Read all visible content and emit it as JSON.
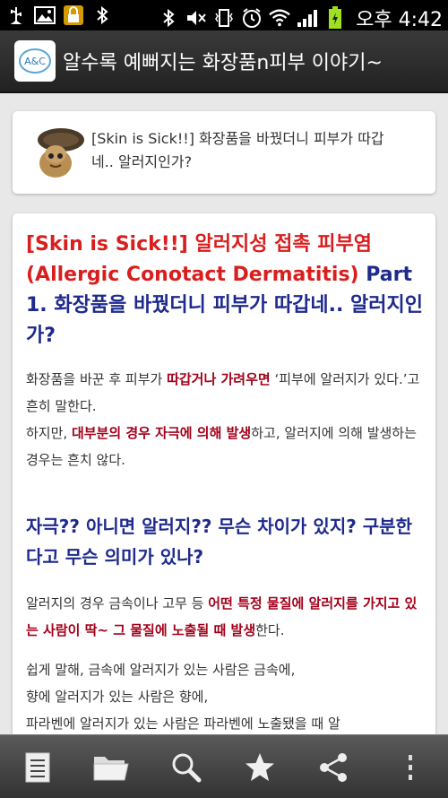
{
  "status_bar": {
    "left_icons": [
      "usb-icon",
      "image-icon",
      "lock-icon",
      "bluetooth-icon"
    ],
    "right_icons": [
      "bluetooth-icon",
      "mute-icon",
      "vibrate-icon",
      "alarm-icon",
      "wifi-icon",
      "signal-icon",
      "battery-icon"
    ],
    "clock": "오후 4:42"
  },
  "action_bar": {
    "app_logo_text": "A&C",
    "title": "알수록 예뻐지는 화장품n피부 이야기~"
  },
  "preview": {
    "title": "[Skin is Sick!!] 화장품을 바꿨더니 피부가 따갑네.. 알러지인가?"
  },
  "article": {
    "title_red": "[Skin is Sick!!] 알러지성 접촉 피부염 (Allergic Conotact Dermatitis)",
    "title_navy": " Part 1. 화장품을 바꿨더니 피부가 따갑네.. 알러지인가?",
    "p1": {
      "a": "화장품을 바꾼 후 피부가 ",
      "b": "따갑거나 가려우면",
      "c": " ‘피부에 알러지가 있다.’고 흔히 말한다."
    },
    "p2": {
      "a": "하지만, ",
      "b": "대부분의 경우 자극에 의해 발생",
      "c": "하고, 알러지에 의해 발생하는 경우는 흔치 않다."
    },
    "h2": "자극?? 아니면 알러지?? 무슨 차이가 있지? 구분한다고 무슨 의미가 있나?",
    "p3": {
      "a": "알러지의 경우 금속이나 고무 등 ",
      "b": "어떤 특정 물질에 알러지를 가지고 있는 사람이 딱~ 그 물질에 노출될 때 발생",
      "c": "한다."
    },
    "p4_line1": "쉽게 말해, 금속에 알러지가 있는 사람은 금속에,",
    "p4_line2": "향에 알러지가 있는 사람은 향에,",
    "p4_line3": "파라벤에 알러지가 있는 사람은 파라벤에 노출됐을 때 알"
  },
  "bottom_bar": {
    "buttons": [
      "list-icon",
      "folder-icon",
      "search-icon",
      "star-icon",
      "share-icon",
      "overflow-menu-icon"
    ]
  }
}
